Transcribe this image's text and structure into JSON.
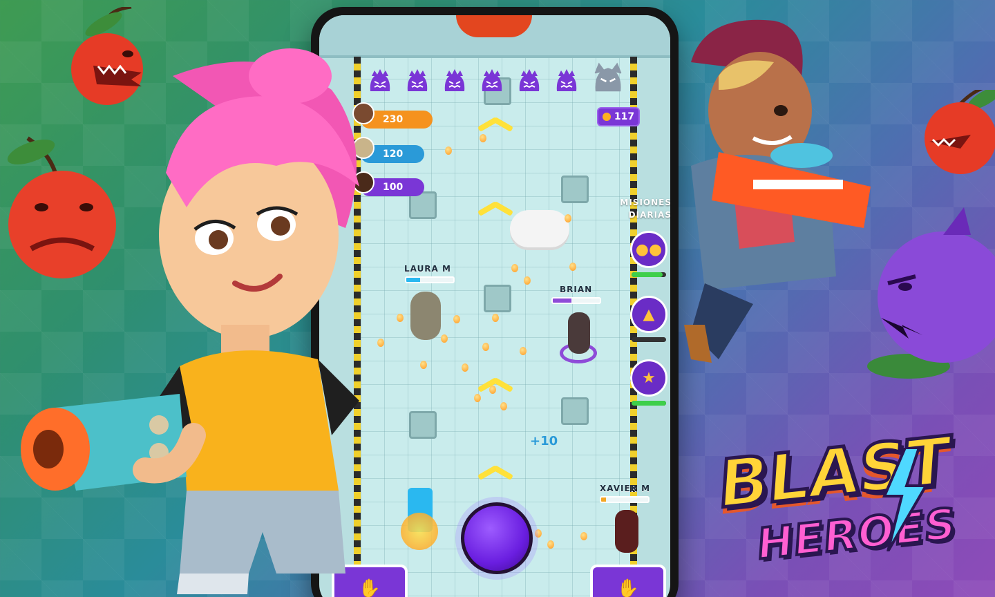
{
  "logo": {
    "blast": "BLAST",
    "heroes": "HEROES"
  },
  "enemies_remaining": {
    "active": 6,
    "boss": 1
  },
  "players": [
    {
      "score": "230",
      "color": "#f5921e"
    },
    {
      "score": "120",
      "color": "#2a9ad8"
    },
    {
      "score": "100",
      "color": "#7a36d6"
    }
  ],
  "coins": "117",
  "missions": {
    "title_line1": "MISIONES",
    "title_line2": "DIARIAS",
    "items": [
      {
        "icon": "group-icon",
        "progress": 0.9,
        "color": "#3ecf4a"
      },
      {
        "icon": "totem-icon",
        "progress": 0.0,
        "color": "#3ecf4a"
      },
      {
        "icon": "trophy-icon",
        "progress": 1.0,
        "color": "#3ecf4a"
      }
    ]
  },
  "characters": [
    {
      "name": "LAURA M",
      "health": 0.3,
      "color": "#2ab8f0"
    },
    {
      "name": "BRIAN",
      "health": 0.4,
      "color": "#8e4bd8"
    },
    {
      "name": "XAVIER M",
      "health": 0.1,
      "color": "#f5a623"
    }
  ],
  "pickup_text": "+10",
  "colors": {
    "accent": "#7a36d6",
    "coin": "#ffb120",
    "arena": "#c9ecec",
    "stripe": "#f0d02c"
  }
}
